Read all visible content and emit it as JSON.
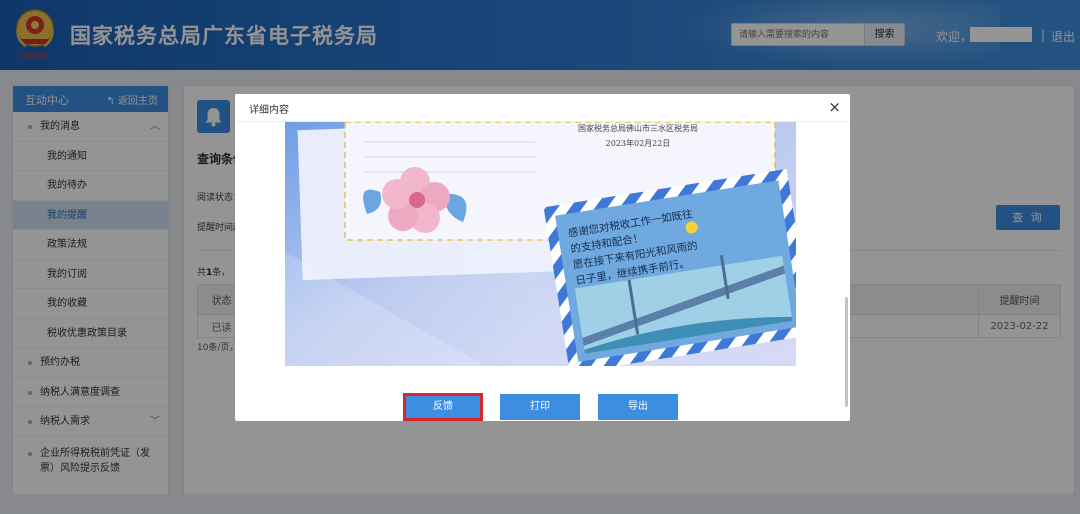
{
  "header": {
    "site_title": "国家税务总局广东省电子税务局",
    "search_placeholder": "请输入需要搜索的内容",
    "search_button": "搜索",
    "welcome": "欢迎，",
    "user_suffix": "...",
    "separator": "|",
    "logout": "退出",
    "emblem_caption": "中国税务"
  },
  "sidebar": {
    "title": "互动中心",
    "back_label": "返回主页",
    "items": [
      {
        "label": "我的消息",
        "level": "top",
        "chevron": "up"
      },
      {
        "label": "我的通知",
        "level": "sub"
      },
      {
        "label": "我的待办",
        "level": "sub"
      },
      {
        "label": "我的提醒",
        "level": "sub",
        "active": true
      },
      {
        "label": "政策法规",
        "level": "sub"
      },
      {
        "label": "我的订阅",
        "level": "sub"
      },
      {
        "label": "我的收藏",
        "level": "sub"
      },
      {
        "label": "税收优惠政策目录",
        "level": "sub"
      },
      {
        "label": "预约办税",
        "level": "top"
      },
      {
        "label": "纳税人满意度调查",
        "level": "top"
      },
      {
        "label": "纳税人需求",
        "level": "top",
        "chevron": "down"
      },
      {
        "label": "企业所得税税前凭证（发票）风险提示反馈",
        "level": "top"
      }
    ]
  },
  "main": {
    "query_title": "查询条件",
    "status_label": "阅读状态：",
    "time_label": "提醒时间起",
    "query_button": "查 询",
    "count_prefix": "共",
    "count_value": "1",
    "count_suffix": "条，",
    "table": {
      "headers": {
        "status": "状态",
        "time": "提醒时间"
      },
      "rows": [
        {
          "status": "已读",
          "time": "2023-02-22"
        }
      ]
    },
    "pager_text": "10条/页，"
  },
  "modal": {
    "title": "详细内容",
    "close": "×",
    "card_org": "国家税务总局佛山市三水区税务局",
    "card_date": "2023年02月22日",
    "greeting_lines": [
      "感谢您对税收工作一如既往",
      "的支持和配合！",
      "愿在接下来有阳光和风雨的",
      "日子里，继续携手前行。"
    ],
    "buttons": {
      "feedback": "反馈",
      "print": "打印",
      "export": "导出"
    }
  },
  "colors": {
    "header_blue": "#1c5fb5",
    "accent_blue": "#3d8de1",
    "highlight_red": "#d8262d",
    "active_item_bg": "#cfe1f3"
  },
  "icons": [
    "tax-emblem-icon",
    "back-arrow-icon",
    "chevron-up-icon",
    "chevron-down-icon",
    "bell-icon",
    "close-icon",
    "flower-icon"
  ]
}
